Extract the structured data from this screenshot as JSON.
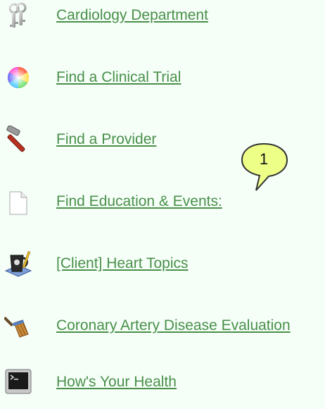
{
  "links": [
    {
      "label": "Cardiology Department",
      "icon": "keys-icon"
    },
    {
      "label": "Find a Clinical Trial",
      "icon": "color-wheel-icon"
    },
    {
      "label": "Find a Provider",
      "icon": "hammer-icon"
    },
    {
      "label": "Find Education & Events:",
      "icon": "document-icon"
    },
    {
      "label": "[Client] Heart Topics",
      "icon": "coffee-mug-pencil-icon"
    },
    {
      "label": "Coronary Artery Disease Evaluation",
      "icon": "broom-icon"
    },
    {
      "label": "How's Your Health",
      "icon": "terminal-icon"
    }
  ],
  "callout": {
    "label": "1"
  },
  "colors": {
    "background": "#f5fff8",
    "link": "#4a8f4a",
    "callout_fill": "#eeff88",
    "callout_border": "#333333"
  }
}
